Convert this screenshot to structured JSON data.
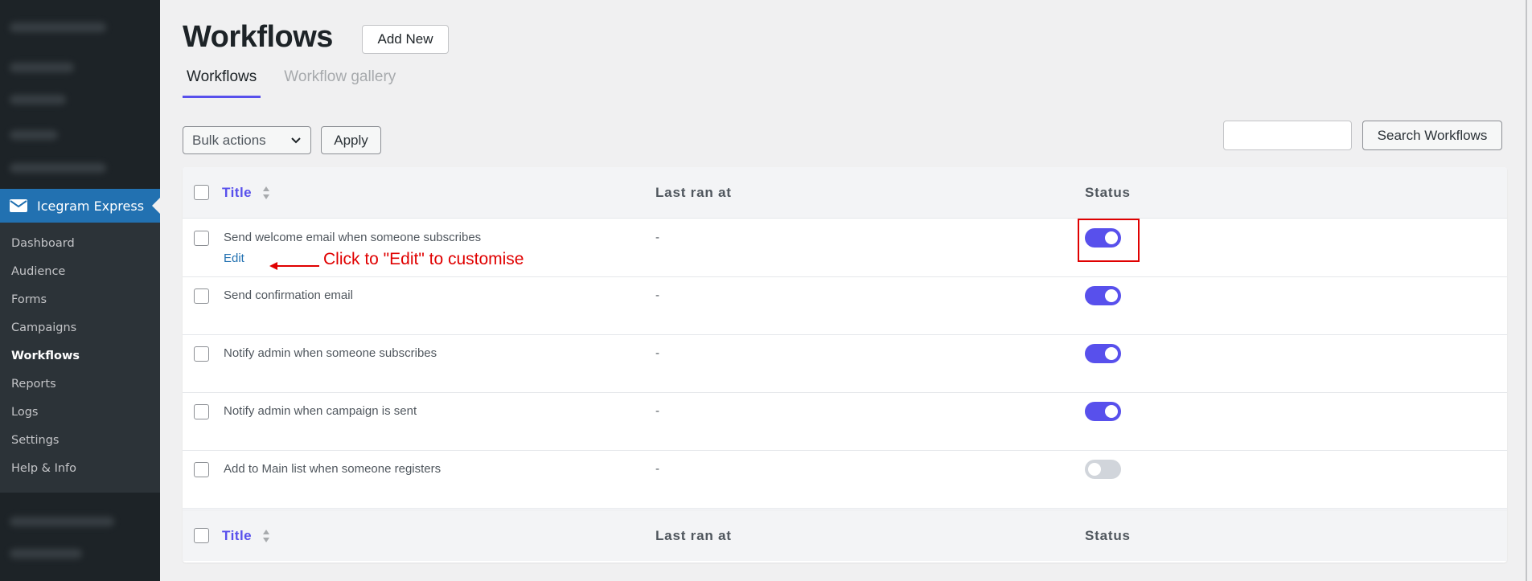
{
  "sidebar": {
    "plugin_name": "Icegram Express",
    "items": [
      {
        "label": "Dashboard"
      },
      {
        "label": "Audience"
      },
      {
        "label": "Forms"
      },
      {
        "label": "Campaigns"
      },
      {
        "label": "Workflows"
      },
      {
        "label": "Reports"
      },
      {
        "label": "Logs"
      },
      {
        "label": "Settings"
      },
      {
        "label": "Help & Info"
      }
    ]
  },
  "header": {
    "title": "Workflows",
    "add_new_label": "Add New"
  },
  "tabs": [
    {
      "label": "Workflows"
    },
    {
      "label": "Workflow gallery"
    }
  ],
  "toolbar": {
    "bulk_actions_label": "Bulk actions",
    "apply_label": "Apply",
    "search_value": "",
    "search_button_label": "Search Workflows"
  },
  "table": {
    "columns": [
      "Title",
      "Last ran at",
      "Status"
    ],
    "rows": [
      {
        "title": "Send welcome email when someone subscribes",
        "last_ran": "-",
        "active": true,
        "edit_label": "Edit"
      },
      {
        "title": "Send confirmation email",
        "last_ran": "-",
        "active": true
      },
      {
        "title": "Notify admin when someone subscribes",
        "last_ran": "-",
        "active": true
      },
      {
        "title": "Notify admin when campaign is sent",
        "last_ran": "-",
        "active": true
      },
      {
        "title": "Add to Main list when someone registers",
        "last_ran": "-",
        "active": false
      }
    ]
  },
  "annotation": {
    "text": "Click to \"Edit\" to customise",
    "color": "#e00000"
  },
  "colors": {
    "accent": "#5850ec",
    "sidebar_bg": "#1d2327",
    "active_menu": "#2271b1"
  }
}
